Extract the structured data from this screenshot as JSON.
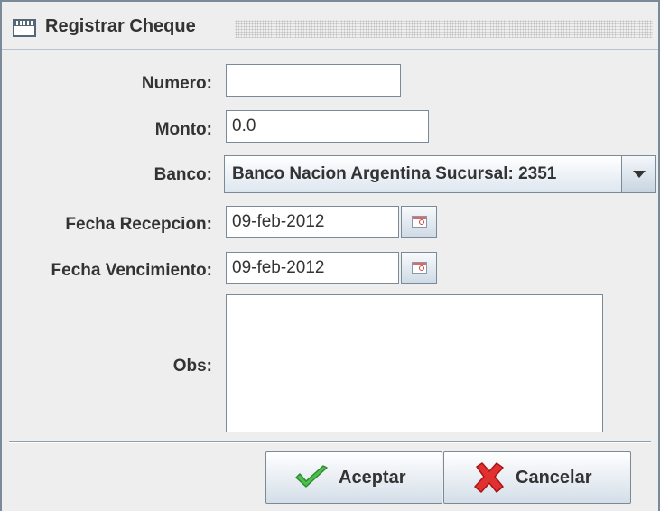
{
  "window": {
    "title": "Registrar Cheque"
  },
  "form": {
    "numero": {
      "label": "Numero:",
      "value": ""
    },
    "monto": {
      "label": "Monto:",
      "value": "0.0"
    },
    "banco": {
      "label": "Banco:",
      "selected": "Banco Nacion Argentina Sucursal: 2351"
    },
    "fecha_recepcion": {
      "label": "Fecha Recepcion:",
      "value": "09-feb-2012"
    },
    "fecha_vencimiento": {
      "label": "Fecha Vencimiento:",
      "value": "09-feb-2012"
    },
    "obs": {
      "label": "Obs:",
      "value": ""
    }
  },
  "buttons": {
    "aceptar": {
      "label": "Aceptar",
      "icon": "checkmark-icon",
      "color": "#3aa53a"
    },
    "cancelar": {
      "label": "Cancelar",
      "icon": "cross-icon",
      "color": "#d92020"
    }
  },
  "icons": {
    "window": "window-icon",
    "calendar": "calendar-icon",
    "dropdown": "chevron-down-icon"
  }
}
